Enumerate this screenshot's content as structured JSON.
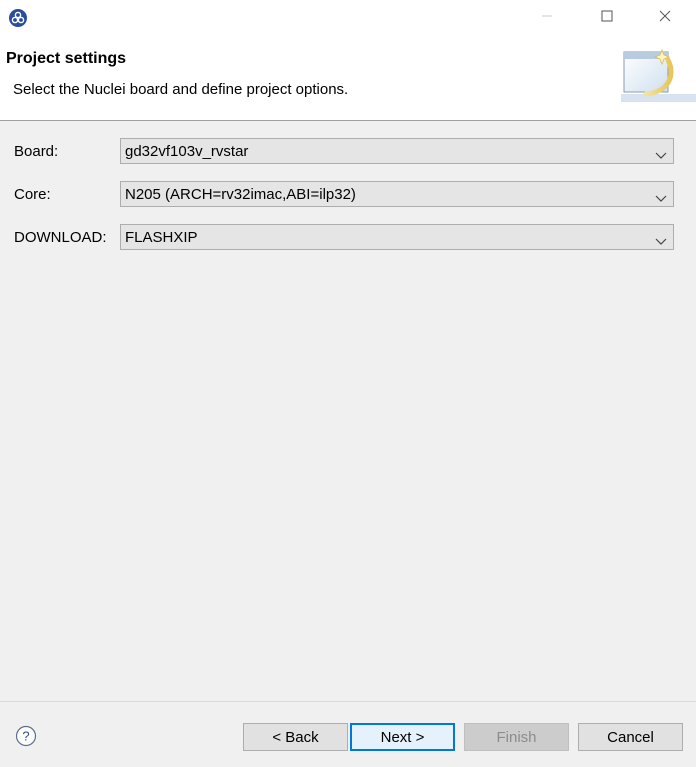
{
  "window": {
    "icon": "nuclei-app-icon",
    "controls": {
      "minimize": "minimize-icon",
      "maximize": "maximize-icon",
      "close": "close-icon"
    }
  },
  "banner": {
    "title": "Project settings",
    "description": "Select the Nuclei board and define project options.",
    "graphic": "wizard-banner-icon"
  },
  "form": {
    "fields": [
      {
        "label": "Board:",
        "value": "gd32vf103v_rvstar"
      },
      {
        "label": "Core:",
        "value": "N205 (ARCH=rv32imac,ABI=ilp32)"
      },
      {
        "label": "DOWNLOAD:",
        "value": "FLASHXIP"
      }
    ]
  },
  "footer": {
    "help_icon": "help-icon",
    "back_label": "< Back",
    "next_label": "Next >",
    "finish_label": "Finish",
    "cancel_label": "Cancel"
  },
  "colors": {
    "accent": "#0078d7",
    "background": "#f0f0f0",
    "banner": "#ffffff"
  }
}
